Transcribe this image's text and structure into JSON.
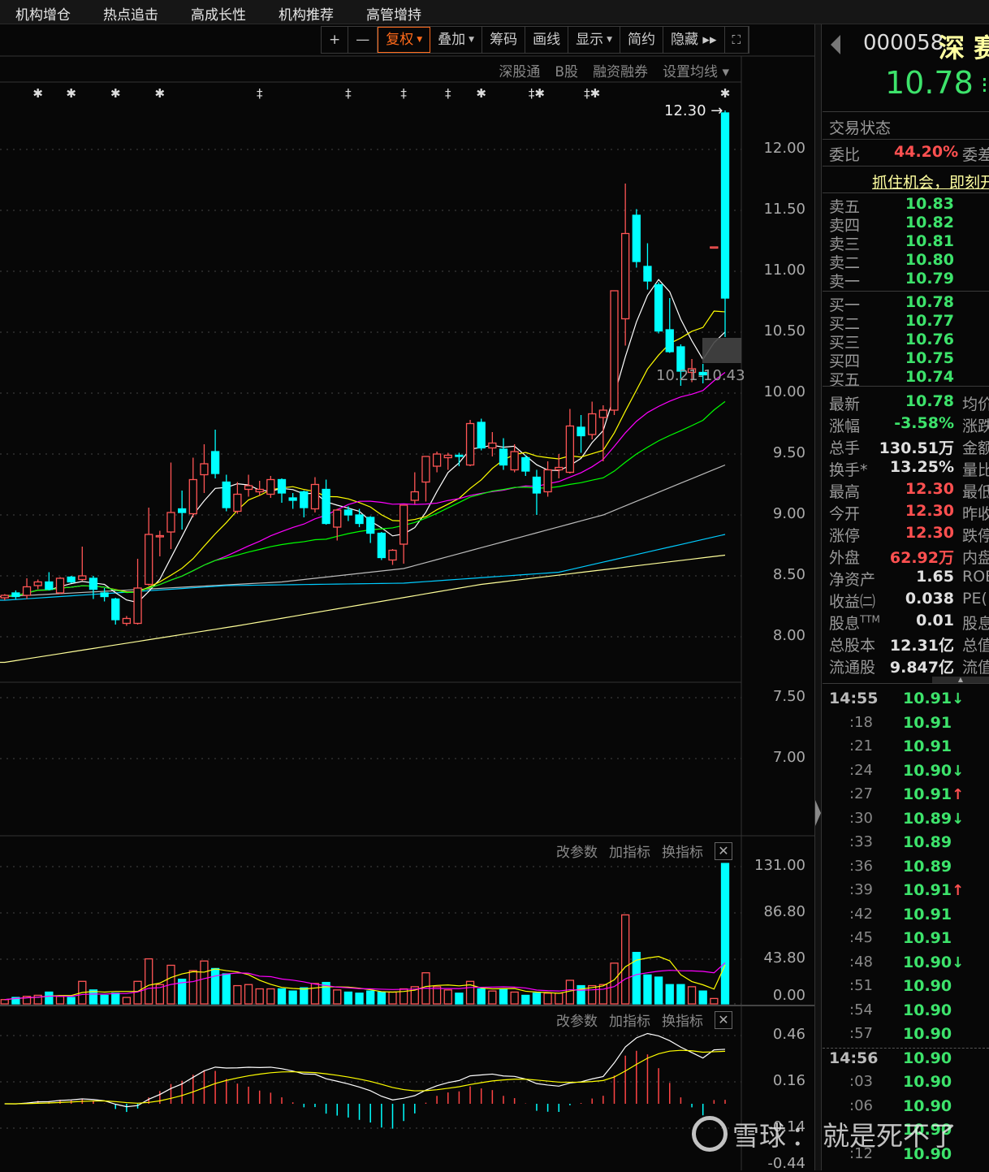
{
  "menubar": {
    "items": [
      "机构增仓",
      "热点追击",
      "高成长性",
      "机构推荐",
      "高管增持"
    ]
  },
  "toolbar": {
    "zoom_in": "+",
    "zoom_out": "—",
    "items": [
      {
        "label": "复权",
        "dropdown": true,
        "active": true
      },
      {
        "label": "叠加",
        "dropdown": true
      },
      {
        "label": "筹码"
      },
      {
        "label": "画线"
      },
      {
        "label": "显示",
        "dropdown": true
      },
      {
        "label": "简约"
      },
      {
        "label": "隐藏 ▸▸"
      }
    ],
    "fullscreen_icon": "fullscreen-icon"
  },
  "sublinks": [
    "深股通",
    "B股",
    "融资融券",
    "设置均线 ▾"
  ],
  "colors": {
    "up": "#ff5555",
    "down": "#00ffff",
    "bg": "#070707",
    "ma5": "#ffffff",
    "ma10": "#ffff00",
    "ma20": "#ff00ff",
    "ma30": "#00ff00",
    "ma60": "#bbbbbb",
    "ma120": "#00ccff",
    "ma250": "#ffff99",
    "quote_green": "#3de36b",
    "quote_red": "#ff5050",
    "name_yellow": "#ffffa0"
  },
  "price_axis": [
    "12.00",
    "11.50",
    "11.00",
    "10.50",
    "10.00",
    "9.50",
    "9.00",
    "8.50",
    "8.00",
    "7.50",
    "7.00"
  ],
  "volume_axis": [
    "131.00",
    "86.80",
    "43.80",
    "0.00"
  ],
  "macd_axis": [
    "0.46",
    "0.16",
    "-0.14",
    "-0.44"
  ],
  "panel_tools": [
    "改参数",
    "加指标",
    "换指标"
  ],
  "annotations": {
    "high_label": "12.30",
    "range_label": "10.21-10.43"
  },
  "chart_data": [
    {
      "type": "candlestick",
      "ylim": [
        7.0,
        12.3
      ],
      "ohlc": [
        [
          8.32,
          8.35,
          8.3,
          8.34
        ],
        [
          8.36,
          8.38,
          8.31,
          8.33
        ],
        [
          8.34,
          8.48,
          8.31,
          8.41
        ],
        [
          8.42,
          8.47,
          8.39,
          8.45
        ],
        [
          8.45,
          8.53,
          8.38,
          8.39
        ],
        [
          8.36,
          8.49,
          8.35,
          8.48
        ],
        [
          8.49,
          8.5,
          8.44,
          8.45
        ],
        [
          8.47,
          8.74,
          8.46,
          8.5
        ],
        [
          8.48,
          8.5,
          8.31,
          8.39
        ],
        [
          8.36,
          8.4,
          8.29,
          8.33
        ],
        [
          8.31,
          8.32,
          8.1,
          8.14
        ],
        [
          8.11,
          8.17,
          8.09,
          8.15
        ],
        [
          8.11,
          8.64,
          8.1,
          8.4
        ],
        [
          8.43,
          9.06,
          8.42,
          8.84
        ],
        [
          8.82,
          8.87,
          8.66,
          8.83
        ],
        [
          8.86,
          9.43,
          8.72,
          9.02
        ],
        [
          9.05,
          9.2,
          8.88,
          9.02
        ],
        [
          9.01,
          9.47,
          8.98,
          9.29
        ],
        [
          9.33,
          9.58,
          9.18,
          9.42
        ],
        [
          9.52,
          9.7,
          9.3,
          9.34
        ],
        [
          9.27,
          9.33,
          9.03,
          9.06
        ],
        [
          9.03,
          9.27,
          9.01,
          9.17
        ],
        [
          9.21,
          9.33,
          9.15,
          9.24
        ],
        [
          9.19,
          9.28,
          9.16,
          9.21
        ],
        [
          9.17,
          9.32,
          9.14,
          9.29
        ],
        [
          9.29,
          9.3,
          9.1,
          9.18
        ],
        [
          9.14,
          9.18,
          9.05,
          9.12
        ],
        [
          9.19,
          9.2,
          8.98,
          9.06
        ],
        [
          9.05,
          9.31,
          9.02,
          9.25
        ],
        [
          9.21,
          9.29,
          8.92,
          8.93
        ],
        [
          8.9,
          9.05,
          8.79,
          9.04
        ],
        [
          9.04,
          9.07,
          8.95,
          9.0
        ],
        [
          9.0,
          9.05,
          8.9,
          8.93
        ],
        [
          8.98,
          8.99,
          8.77,
          8.85
        ],
        [
          8.85,
          8.86,
          8.63,
          8.65
        ],
        [
          8.63,
          8.72,
          8.59,
          8.71
        ],
        [
          8.76,
          9.08,
          8.6,
          9.08
        ],
        [
          9.12,
          9.35,
          9.09,
          9.19
        ],
        [
          9.27,
          9.48,
          9.11,
          9.48
        ],
        [
          9.4,
          9.52,
          9.35,
          9.5
        ],
        [
          9.47,
          9.51,
          9.37,
          9.49
        ],
        [
          9.49,
          9.51,
          9.4,
          9.48
        ],
        [
          9.41,
          9.78,
          9.4,
          9.75
        ],
        [
          9.76,
          9.79,
          9.53,
          9.55
        ],
        [
          9.55,
          9.68,
          9.48,
          9.59
        ],
        [
          9.54,
          9.63,
          9.37,
          9.41
        ],
        [
          9.37,
          9.58,
          9.35,
          9.52
        ],
        [
          9.47,
          9.49,
          9.32,
          9.36
        ],
        [
          9.31,
          9.37,
          9.0,
          9.18
        ],
        [
          9.19,
          9.44,
          9.15,
          9.37
        ],
        [
          9.37,
          9.5,
          9.3,
          9.39
        ],
        [
          9.35,
          9.87,
          9.34,
          9.73
        ],
        [
          9.72,
          9.82,
          9.51,
          9.65
        ],
        [
          9.66,
          9.93,
          9.62,
          9.83
        ],
        [
          9.8,
          9.9,
          9.44,
          9.86
        ],
        [
          9.86,
          10.84,
          9.82,
          10.84
        ],
        [
          10.61,
          11.72,
          10.39,
          11.31
        ],
        [
          11.46,
          11.51,
          11.03,
          11.08
        ],
        [
          11.04,
          11.23,
          10.85,
          10.92
        ],
        [
          10.89,
          10.91,
          10.49,
          10.51
        ],
        [
          10.52,
          10.78,
          10.33,
          10.34
        ],
        [
          10.38,
          10.4,
          10.06,
          10.18
        ],
        [
          10.17,
          10.28,
          10.09,
          10.2
        ],
        [
          10.17,
          10.24,
          10.08,
          10.15
        ],
        [
          11.2,
          11.2,
          11.2,
          11.2
        ],
        [
          12.3,
          12.32,
          10.46,
          10.78
        ]
      ],
      "computed_ma_periods": [
        5,
        10,
        20,
        30
      ],
      "long_ma": [
        {
          "color_key": "ma60",
          "points": [
            [
              0,
              8.33
            ],
            [
              25,
              8.45
            ],
            [
              36,
              8.56
            ],
            [
              54,
              9.0
            ],
            [
              65,
              9.41
            ]
          ]
        },
        {
          "color_key": "ma120",
          "points": [
            [
              0,
              8.3
            ],
            [
              20,
              8.42
            ],
            [
              36,
              8.44
            ],
            [
              50,
              8.53
            ],
            [
              65,
              8.84
            ]
          ]
        },
        {
          "color_key": "ma250",
          "points": [
            [
              0,
              7.79
            ],
            [
              21,
              8.09
            ],
            [
              43,
              8.43
            ],
            [
              65,
              8.67
            ]
          ]
        }
      ],
      "markers": [
        [
          3,
          "✱"
        ],
        [
          6,
          "✱"
        ],
        [
          10,
          "✱"
        ],
        [
          14,
          "✱"
        ],
        [
          23,
          "‡"
        ],
        [
          31,
          "‡"
        ],
        [
          36,
          "‡"
        ],
        [
          40,
          "‡"
        ],
        [
          43,
          "✱"
        ],
        [
          48,
          "‡✱"
        ],
        [
          53,
          "‡✱"
        ],
        [
          65,
          "✱"
        ]
      ]
    },
    {
      "type": "bar",
      "ylim": [
        0,
        131
      ],
      "values": [
        4,
        6,
        7,
        8,
        11,
        7,
        6,
        21,
        13,
        8,
        10,
        6,
        21,
        42,
        18,
        36,
        23,
        31,
        40,
        33,
        28,
        17,
        18,
        14,
        14,
        14,
        12,
        15,
        19,
        20,
        13,
        11,
        10,
        12,
        11,
        11,
        14,
        16,
        29,
        16,
        13,
        10,
        21,
        14,
        12,
        14,
        11,
        8,
        10,
        10,
        10,
        22,
        17,
        17,
        18,
        38,
        83,
        48,
        27,
        25,
        18,
        18,
        16,
        12,
        5,
        131
      ],
      "computed_ma_periods": [
        5,
        10
      ]
    },
    {
      "type": "macd",
      "ylim": [
        -0.44,
        0.46
      ],
      "params": [
        12,
        26,
        9
      ]
    }
  ],
  "quote": {
    "code": "000058",
    "name": "深 赛",
    "price": "10.78",
    "trade_status_label": "交易状态",
    "weibi_label": "委比",
    "weibi_value": "44.20%",
    "weicha_label": "委差",
    "promo_link": "抓住机会，即刻开",
    "asks": [
      {
        "label": "卖五",
        "price": "10.83"
      },
      {
        "label": "卖四",
        "price": "10.82"
      },
      {
        "label": "卖三",
        "price": "10.81"
      },
      {
        "label": "卖二",
        "price": "10.80"
      },
      {
        "label": "卖一",
        "price": "10.79"
      }
    ],
    "bids": [
      {
        "label": "买一",
        "price": "10.78"
      },
      {
        "label": "买二",
        "price": "10.77"
      },
      {
        "label": "买三",
        "price": "10.76"
      },
      {
        "label": "买四",
        "price": "10.75"
      },
      {
        "label": "买五",
        "price": "10.74"
      }
    ],
    "stats": [
      {
        "label": "最新",
        "value": "10.78",
        "color": "green",
        "label2": "均价"
      },
      {
        "label": "涨幅",
        "value": "-3.58%",
        "color": "green",
        "label2": "涨跌"
      },
      {
        "label": "总手",
        "value": "130.51万",
        "color": "white",
        "label2": "金额"
      },
      {
        "label": "换手*",
        "value": "13.25%",
        "color": "white",
        "label2": "量比"
      },
      {
        "label": "最高",
        "value": "12.30",
        "color": "red",
        "label2": "最低"
      },
      {
        "label": "今开",
        "value": "12.30",
        "color": "red",
        "label2": "昨收"
      },
      {
        "label": "涨停",
        "value": "12.30",
        "color": "red",
        "label2": "跌停"
      },
      {
        "label": "外盘",
        "value": "62.92万",
        "color": "red",
        "label2": "内盘"
      },
      {
        "label": "净资产",
        "value": "1.65",
        "color": "white",
        "label2": "ROE"
      },
      {
        "label": "收益㈡",
        "value": "0.038",
        "color": "white",
        "label2": "PE("
      },
      {
        "label": "股息",
        "sup": "TTM",
        "value": "0.01",
        "color": "white",
        "label2": "股息"
      },
      {
        "label": "总股本",
        "value": "12.31亿",
        "color": "white",
        "label2": "总值"
      },
      {
        "label": "流通股",
        "value": "9.847亿",
        "color": "white",
        "label2": "流值"
      }
    ],
    "ticks": [
      {
        "time": "14:55",
        "major": true,
        "price": "10.91",
        "dir": "down"
      },
      {
        "time": ":18",
        "price": "10.91"
      },
      {
        "time": ":21",
        "price": "10.91"
      },
      {
        "time": ":24",
        "price": "10.90",
        "dir": "down"
      },
      {
        "time": ":27",
        "price": "10.91",
        "dir": "up"
      },
      {
        "time": ":30",
        "price": "10.89",
        "dir": "down"
      },
      {
        "time": ":33",
        "price": "10.89"
      },
      {
        "time": ":36",
        "price": "10.89"
      },
      {
        "time": ":39",
        "price": "10.91",
        "dir": "up"
      },
      {
        "time": ":42",
        "price": "10.91"
      },
      {
        "time": ":45",
        "price": "10.91"
      },
      {
        "time": ":48",
        "price": "10.90",
        "dir": "down"
      },
      {
        "time": ":51",
        "price": "10.90"
      },
      {
        "time": ":54",
        "price": "10.90"
      },
      {
        "time": ":57",
        "price": "10.90"
      },
      {
        "time": "14:56",
        "major": true,
        "price": "10.90"
      },
      {
        "time": ":03",
        "price": "10.90"
      },
      {
        "time": ":06",
        "price": "10.90"
      },
      {
        "time": "",
        "price": "10.90"
      },
      {
        "time": ":12",
        "price": "10.90"
      }
    ]
  },
  "watermark": {
    "brand": "雪球",
    "separator": "：",
    "text": "就是死不了"
  }
}
